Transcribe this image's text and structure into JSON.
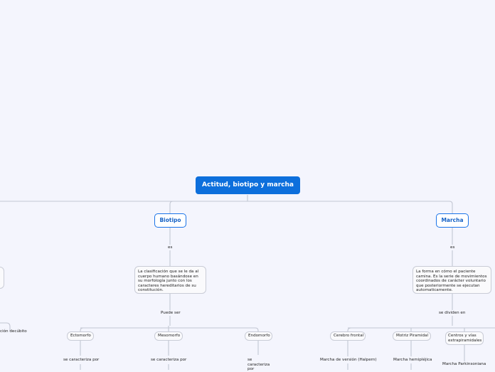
{
  "central": "Actitud, biotipo y marcha",
  "biotipo": {
    "title": "Biotipo",
    "link": "es",
    "definition": "La clasificación que se le da al cuerpo humano basándose en su morfología junto con los caracteres hereditarios de su constitución.",
    "link2": "Puede ser",
    "types": [
      {
        "name": "Ectomorfo",
        "link": "se caracteriza por"
      },
      {
        "name": "Mesomorfo",
        "link": "se caracteriza por"
      },
      {
        "name": "Endomorfo",
        "link_lines": [
          "se",
          "caracteriza",
          "por"
        ]
      }
    ]
  },
  "marcha": {
    "title": "Marcha",
    "link": "es",
    "definition": "La forma en cómo el paciente camina. Es la serie de movimientos coordinados de carácter voluntario que posteriormente se ejecutan automaticamente.",
    "link2": "se dividen en",
    "types": [
      {
        "name": "Cerebro frontal",
        "child": "Marcha de versión (Halpern)"
      },
      {
        "name": "Motriz Piramidal",
        "child": "Marcha hemipléjica"
      },
      {
        "name": "Centros y vías extrapiramidales",
        "child": "Marcha Parkinsoniana"
      }
    ]
  },
  "left_partial": "ción decúbito"
}
